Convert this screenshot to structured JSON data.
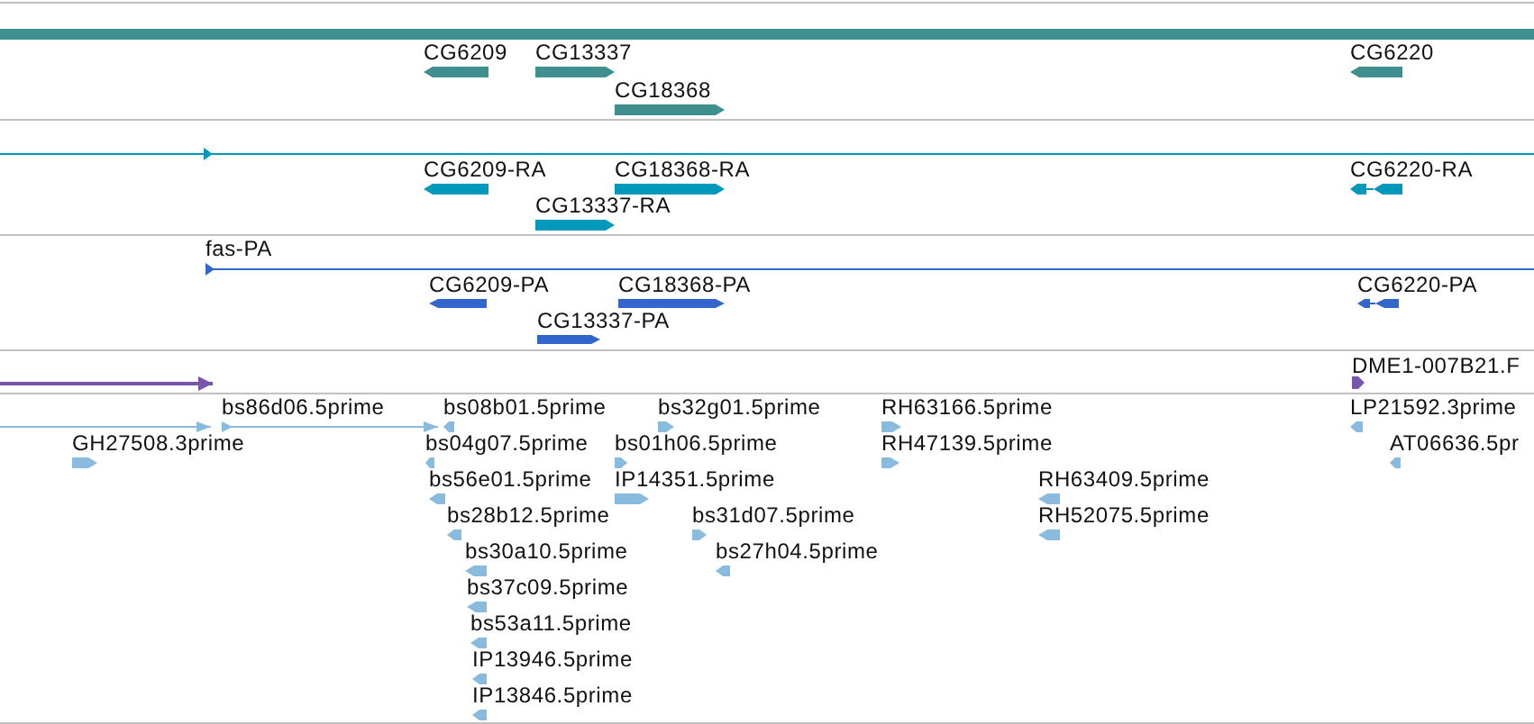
{
  "tracks": [
    {
      "color": "#3f8f8f",
      "features": [
        {
          "kind": "span"
        },
        {
          "label": "CG6209",
          "reverse": true
        },
        {
          "label": "CG13337",
          "reverse": false
        },
        {
          "label": "CG6220",
          "reverse": true
        },
        {
          "label": "CG18368",
          "reverse": false
        }
      ]
    },
    {
      "color": "#0099bb",
      "features": [
        {
          "reverse": false
        },
        {
          "label": "CG6209-RA",
          "reverse": true
        },
        {
          "label": "CG18368-RA",
          "reverse": false
        },
        {
          "label": "CG6220-RA",
          "reverse": true
        },
        {
          "label": "CG13337-RA",
          "reverse": false
        }
      ]
    },
    {
      "color": "#3366cc",
      "features": [
        {
          "label": "fas-PA",
          "reverse": false
        },
        {
          "label": "CG6209-PA",
          "reverse": true
        },
        {
          "label": "CG18368-PA",
          "reverse": false
        },
        {
          "label": "CG6220-PA",
          "reverse": true
        },
        {
          "label": "CG13337-PA",
          "reverse": false
        }
      ]
    },
    {
      "color": "#7755aa",
      "features": [
        {
          "reverse": false
        },
        {
          "label": "DME1-007B21.F",
          "reverse": false
        }
      ]
    },
    {
      "color": "#88bbdd",
      "features": [
        {
          "reverse": false
        },
        {
          "label": "bs86d06.5prime",
          "reverse": false
        },
        {
          "label": "bs08b01.5prime",
          "reverse": true
        },
        {
          "label": "bs32g01.5prime",
          "reverse": false
        },
        {
          "label": "RH63166.5prime",
          "reverse": false
        },
        {
          "label": "LP21592.3prime",
          "reverse": true
        },
        {
          "label": "GH27508.3prime",
          "reverse": false
        },
        {
          "label": "bs04g07.5prime",
          "reverse": true
        },
        {
          "label": "bs01h06.5prime",
          "reverse": false
        },
        {
          "label": "RH47139.5prime",
          "reverse": false
        },
        {
          "label": "AT06636.5pr",
          "reverse": true
        },
        {
          "label": "bs56e01.5prime",
          "reverse": true
        },
        {
          "label": "IP14351.5prime",
          "reverse": false
        },
        {
          "label": "RH63409.5prime",
          "reverse": true
        },
        {
          "label": "bs28b12.5prime",
          "reverse": true
        },
        {
          "label": "bs31d07.5prime",
          "reverse": false
        },
        {
          "label": "RH52075.5prime",
          "reverse": true
        },
        {
          "label": "bs30a10.5prime",
          "reverse": true
        },
        {
          "label": "bs27h04.5prime",
          "reverse": true
        },
        {
          "label": "bs37c09.5prime",
          "reverse": true
        },
        {
          "label": "bs53a11.5prime",
          "reverse": true
        },
        {
          "label": "IP13946.5prime",
          "reverse": true
        },
        {
          "label": "IP13846.5prime",
          "reverse": true
        }
      ]
    }
  ]
}
